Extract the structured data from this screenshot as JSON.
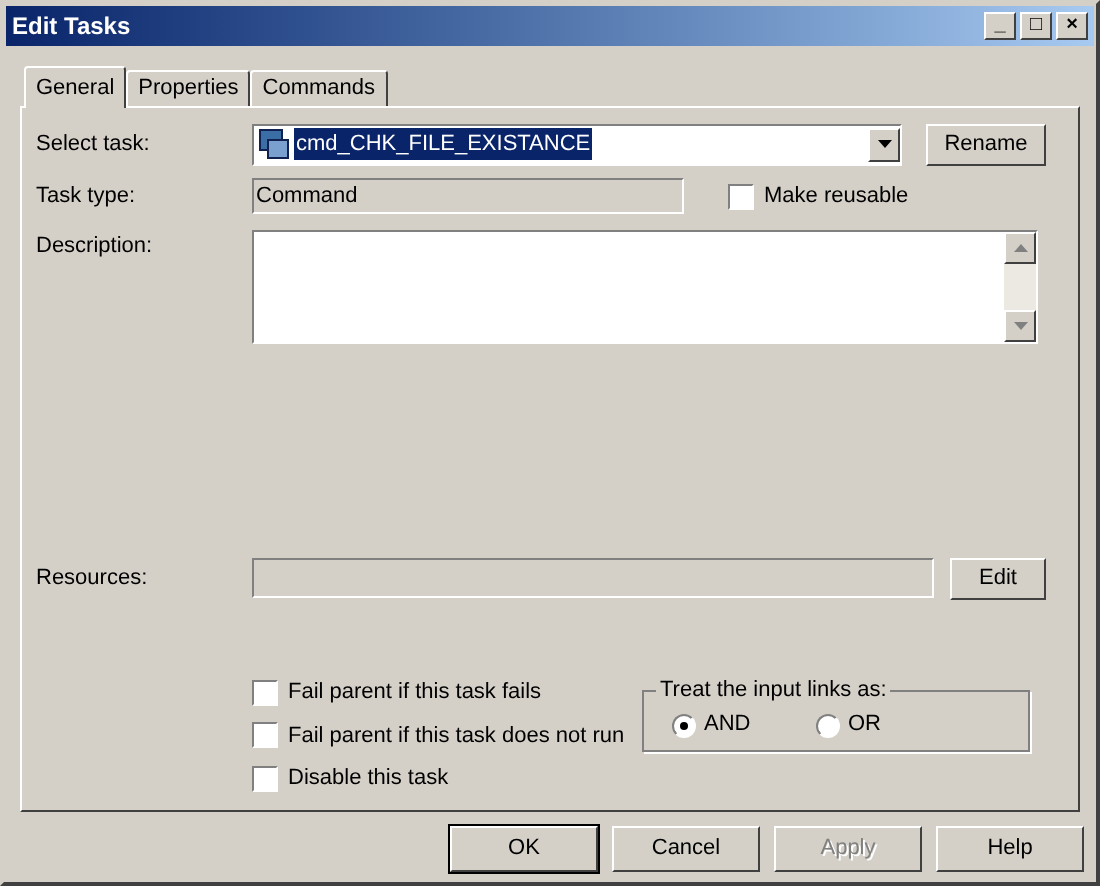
{
  "window": {
    "title": "Edit Tasks",
    "controls": [
      "_",
      "□",
      "×"
    ]
  },
  "tabs": [
    {
      "label": "General",
      "selected": true
    },
    {
      "label": "Properties",
      "selected": false
    },
    {
      "label": "Commands",
      "selected": false
    }
  ],
  "select_task": {
    "label": "Select task:",
    "value": "cmd_CHK_FILE_EXISTANCE",
    "button": "Rename"
  },
  "task_type": {
    "label": "Task type:",
    "value": "Command"
  },
  "make_reusable": {
    "label": "Make reusable",
    "checked": false
  },
  "description": {
    "label": "Description:"
  },
  "resources": {
    "label": "Resources:",
    "button": "Edit"
  },
  "options": [
    {
      "label": "Fail parent if this task fails",
      "checked": false
    },
    {
      "label": "Fail parent if this task does not run",
      "checked": false
    },
    {
      "label": "Disable this task",
      "checked": false
    }
  ],
  "input_links": {
    "title": "Treat the input links as:",
    "choices": [
      {
        "label": "AND",
        "selected": true
      },
      {
        "label": "OR",
        "selected": false
      }
    ]
  },
  "buttons": [
    {
      "label": "OK",
      "disabled": false,
      "default": true
    },
    {
      "label": "Cancel",
      "disabled": false,
      "default": false
    },
    {
      "label": "Apply",
      "disabled": true,
      "default": false
    },
    {
      "label": "Help",
      "disabled": false,
      "default": false
    }
  ]
}
